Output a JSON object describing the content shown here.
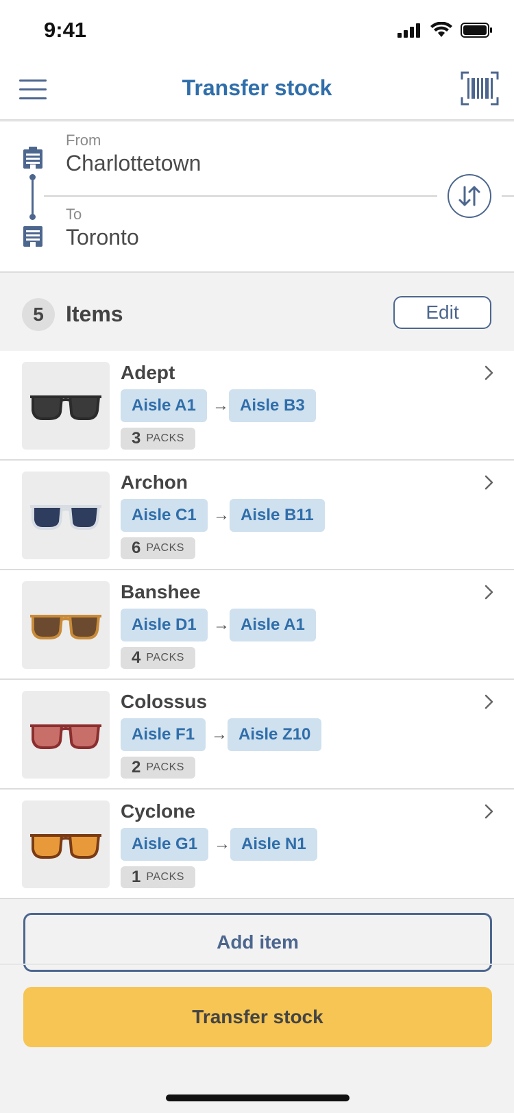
{
  "status_bar": {
    "time": "9:41"
  },
  "nav": {
    "title": "Transfer stock"
  },
  "route": {
    "from_label": "From",
    "from_value": "Charlottetown",
    "to_label": "To",
    "to_value": "Toronto"
  },
  "items_header": {
    "count": "5",
    "title": "Items",
    "edit_label": "Edit"
  },
  "items": [
    {
      "name": "Adept",
      "from_aisle": "Aisle A1",
      "to_aisle": "Aisle B3",
      "packs": "3",
      "packs_label": "PACKS",
      "glasses_frame": "#2b2b2b",
      "glasses_lens": "#3a3a3a"
    },
    {
      "name": "Archon",
      "from_aisle": "Aisle C1",
      "to_aisle": "Aisle B11",
      "packs": "6",
      "packs_label": "PACKS",
      "glasses_frame": "#d7dde3",
      "glasses_lens": "#2e3c5e"
    },
    {
      "name": "Banshee",
      "from_aisle": "Aisle D1",
      "to_aisle": "Aisle A1",
      "packs": "4",
      "packs_label": "PACKS",
      "glasses_frame": "#c98b3a",
      "glasses_lens": "#6b4a2f"
    },
    {
      "name": "Colossus",
      "from_aisle": "Aisle F1",
      "to_aisle": "Aisle Z10",
      "packs": "2",
      "packs_label": "PACKS",
      "glasses_frame": "#8b2e2e",
      "glasses_lens": "#c96f6a"
    },
    {
      "name": "Cyclone",
      "from_aisle": "Aisle G1",
      "to_aisle": "Aisle N1",
      "packs": "1",
      "packs_label": "PACKS",
      "glasses_frame": "#7a3b14",
      "glasses_lens": "#e89a3a"
    }
  ],
  "actions": {
    "add_item": "Add item",
    "transfer": "Transfer stock"
  },
  "colors": {
    "accent": "#2f6eaa",
    "primary_button": "#f6c553",
    "outline": "#4c668e",
    "chip": "#cfe0ee"
  },
  "icons": {
    "menu": "hamburger-menu-icon",
    "scan": "barcode-scanner-icon",
    "swap": "swap-vertical-icon",
    "from": "store-icon",
    "to": "warehouse-icon",
    "row": "chevron-right-icon"
  }
}
